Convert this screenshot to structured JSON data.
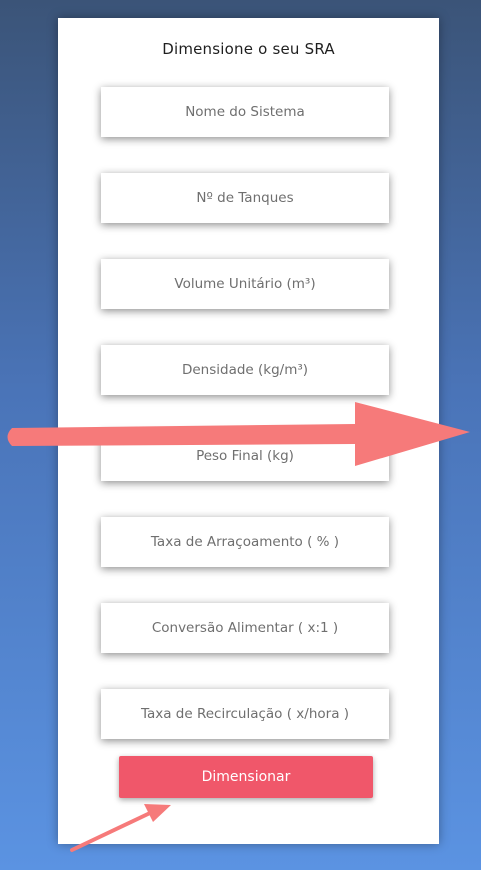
{
  "form": {
    "title": "Dimensione o seu SRA",
    "fields": [
      {
        "placeholder": "Nome do Sistema",
        "value": ""
      },
      {
        "placeholder": "Nº de Tanques",
        "value": ""
      },
      {
        "placeholder": "Volume Unitário (m³)",
        "value": ""
      },
      {
        "placeholder": "Densidade (kg/m³)",
        "value": ""
      },
      {
        "placeholder": "Peso Final (kg)",
        "value": ""
      },
      {
        "placeholder": "Taxa de Arraçoamento ( % )",
        "value": ""
      },
      {
        "placeholder": "Conversão Alimentar ( x:1 )",
        "value": ""
      },
      {
        "placeholder": "Taxa de Recirculação ( x/hora )",
        "value": ""
      }
    ],
    "submit_label": "Dimensionar"
  },
  "colors": {
    "button": "#f0576a",
    "arrow": "#f67a7a"
  }
}
